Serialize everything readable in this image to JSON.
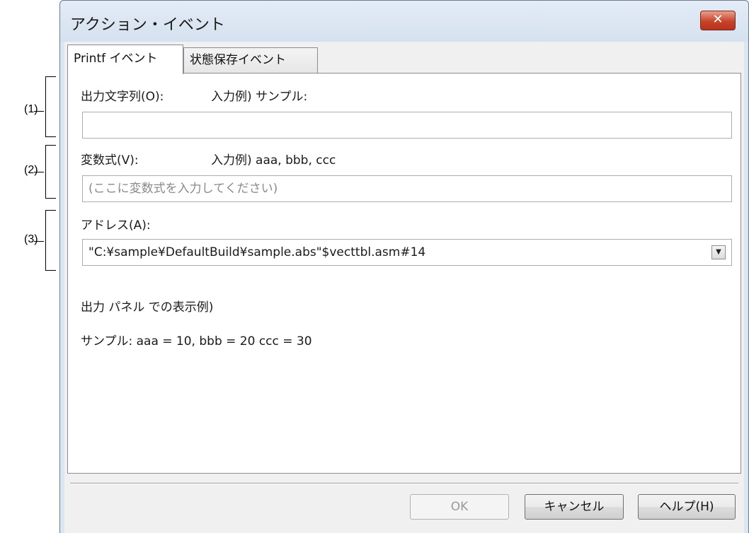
{
  "annotations": [
    "(1)",
    "(2)",
    "(3)"
  ],
  "window": {
    "title": "アクション・イベント",
    "close_label": "✕"
  },
  "tabs": [
    {
      "label": "Printf イベント",
      "active": true
    },
    {
      "label": "状態保存イベント",
      "active": false
    }
  ],
  "form": {
    "output_string_label": "出力文字列(O):",
    "output_string_example": "入力例) サンプル:",
    "output_string_value": "",
    "variable_label": "変数式(V):",
    "variable_example": "入力例) aaa, bbb, ccc",
    "variable_placeholder": "(ここに変数式を入力してください)",
    "address_label": "アドレス(A):",
    "address_value": "\"C:¥sample¥DefaultBuild¥sample.abs\"$vecttbl.asm#14",
    "address_dropdown_icon": "chevron-down-icon"
  },
  "preview": {
    "heading": "出力 パネル での表示例)",
    "text": "サンプル: aaa = 10, bbb = 20 ccc = 30"
  },
  "buttons": {
    "ok": "OK",
    "cancel": "キャンセル",
    "help": "ヘルプ(H)"
  }
}
